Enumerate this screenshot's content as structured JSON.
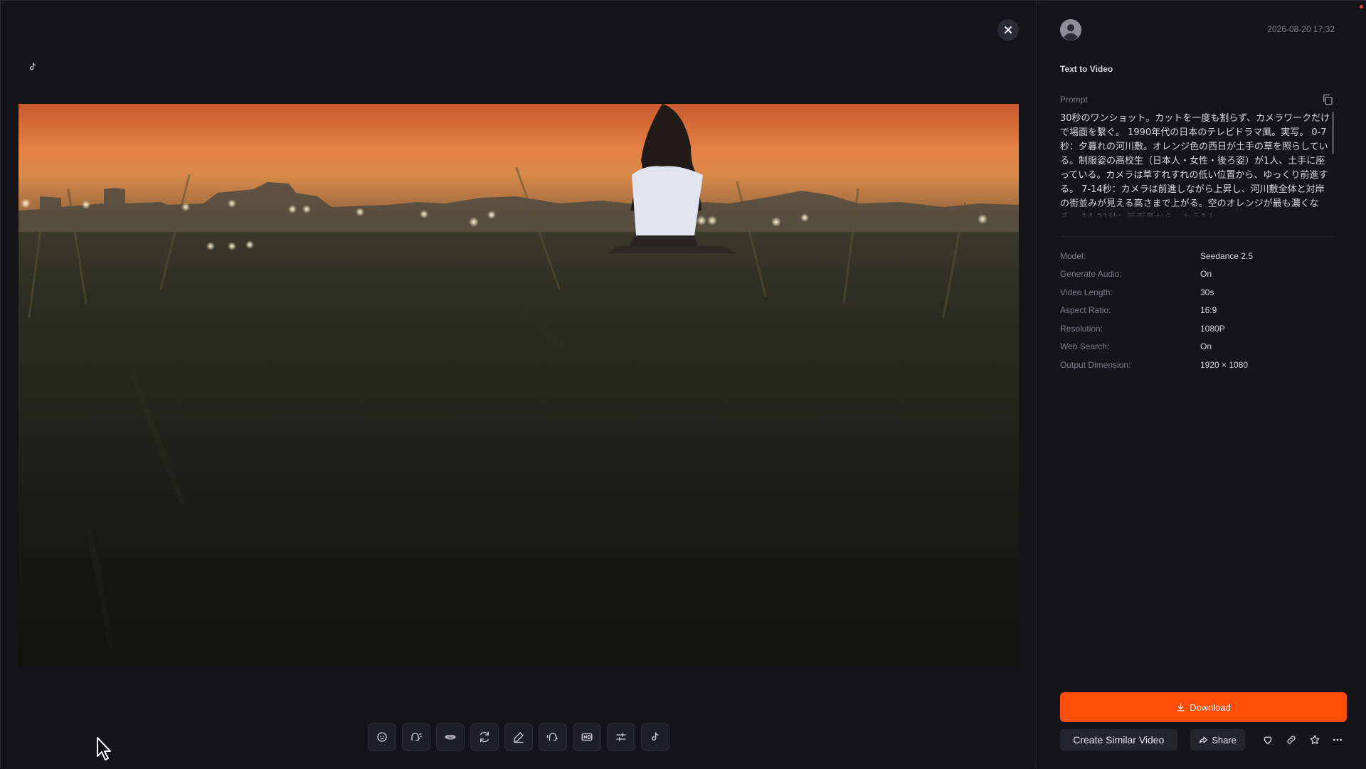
{
  "viewer": {
    "brand_icon": "tiktok-note-icon",
    "close_icon": "close-icon",
    "video_alt": "Video preview: girl sitting on a riverbank at sunset",
    "toolbar": [
      {
        "name": "lip-sync-tool",
        "icon": "face-icon"
      },
      {
        "name": "voice-tool",
        "icon": "speaking-head-icon"
      },
      {
        "name": "mouth-tool",
        "icon": "lips-icon"
      },
      {
        "name": "regenerate-tool",
        "icon": "refresh-icon"
      },
      {
        "name": "edit-tool",
        "icon": "pencil-icon"
      },
      {
        "name": "voiceover-tool",
        "icon": "speech-icon"
      },
      {
        "name": "hd-upscale-tool",
        "icon": "hd-icon"
      },
      {
        "name": "adjust-tool",
        "icon": "sliders-icon"
      },
      {
        "name": "tiktok-tool",
        "icon": "tiktok-note-icon"
      }
    ]
  },
  "panel": {
    "timestamp": "2026-08-20 17:32",
    "mode_title": "Text to Video",
    "prompt_label": "Prompt",
    "prompt_text": "30秒のワンショット。カットを一度も割らず、カメラワークだけで場面を繋ぐ。 1990年代の日本のテレビドラマ風。実写。 0-7秒：夕暮れの河川敷。オレンジ色の西日が土手の草を照らしている。制服姿の高校生（日本人・女性・後ろ姿）が1人、土手に座っている。カメラは草すれすれの低い位置から、ゆっくり前進する。 7-14秒：カメラは前進しながら上昇し、河川敷全体と対岸の街並みが見える高さまで上がる。空のオレンジが最も濃くなる。 14-21秒：画面奥から、もう1人",
    "params": [
      {
        "key": "Model:",
        "value": "Seedance 2.5"
      },
      {
        "key": "Generate Audio:",
        "value": "On"
      },
      {
        "key": "Video Length:",
        "value": "30s"
      },
      {
        "key": "Aspect Ratio:",
        "value": "16:9"
      },
      {
        "key": "Resolution:",
        "value": "1080P"
      },
      {
        "key": "Web Search:",
        "value": "On"
      },
      {
        "key": "Output Dimension:",
        "value": "1920 × 1080"
      }
    ],
    "download_label": "Download",
    "create_similar_label": "Create Similar Video",
    "share_label": "Share",
    "accent_color": "#ff4d0a"
  }
}
